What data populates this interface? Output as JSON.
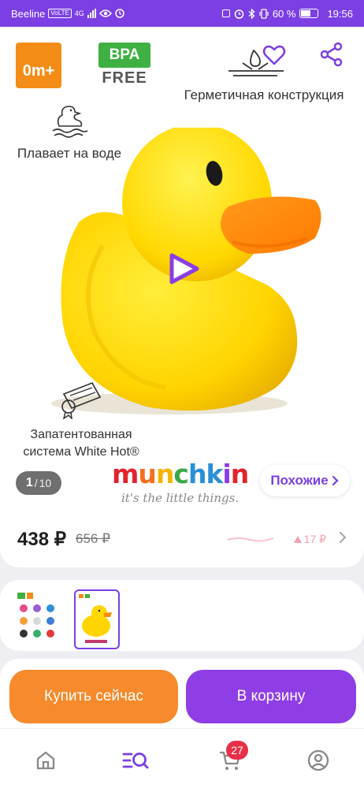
{
  "status_bar": {
    "carrier": "Beeline",
    "volte": "VoLTE",
    "network": "4G",
    "battery_percent": "60 %",
    "time": "19:56"
  },
  "product": {
    "age_badge": "0m+",
    "bpa_top": "BPA",
    "bpa_bottom": "FREE",
    "feature_seal": "Герметичная конструкция",
    "feature_float": "Плавает на воде",
    "feature_patent_line1": "Запатентованная",
    "feature_patent_line2": "система White Hot®",
    "image_counter_current": "1",
    "image_counter_separator": "/",
    "image_counter_total": "10",
    "brand_name": "munchkin",
    "brand_tagline": "it's the little things.",
    "similar_label": "Похожие",
    "price_current": "438 ₽",
    "price_old": "656 ₽",
    "price_change": "17 ₽"
  },
  "actions": {
    "buy_now": "Купить сейчас",
    "add_to_cart": "В корзину"
  },
  "tabbar": {
    "cart_count": "27"
  },
  "colors": {
    "accent": "#7b3fe4",
    "buy_now": "#f68a2c",
    "cart": "#8f3ee6",
    "badge": "#e8304a"
  }
}
